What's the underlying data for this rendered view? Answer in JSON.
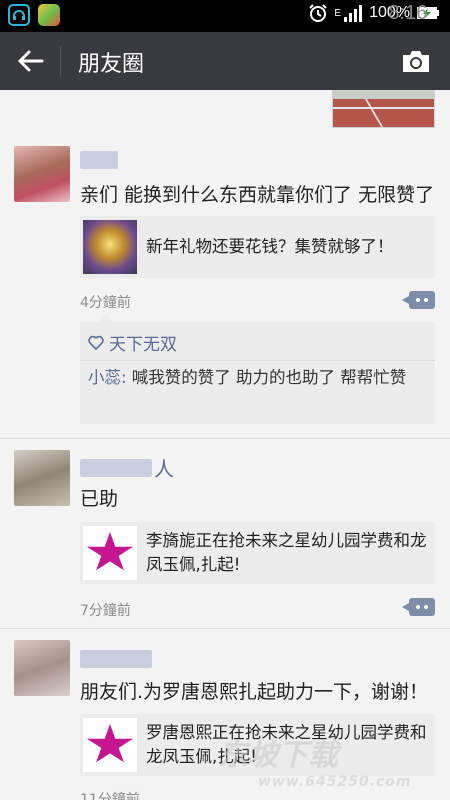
{
  "status_bar": {
    "battery_percent": "100%",
    "time": "8:16",
    "network": "E"
  },
  "app_bar": {
    "title": "朋友圈"
  },
  "posts": [
    {
      "name_suffix": "",
      "text": "亲们 能换到什么东西就靠你们了 无限赞了",
      "share_title": "新年礼物还要花钱？集赞就够了！",
      "time": "4分鐘前",
      "likes": "天下无双",
      "comment_name": "小蕊:",
      "comment_text": " 喊我赞的赞了 助力的也助了  帮帮忙赞"
    },
    {
      "name_suffix": "人",
      "text": "已助",
      "share_title": "李旖旎正在抢未来之星幼儿园学费和龙凤玉佩,扎起!",
      "time": "7分鐘前"
    },
    {
      "name_suffix": "",
      "text": "朋友们.为罗唐恩熙扎起助力一下，谢谢！",
      "share_title": "罗唐恩熙正在抢未来之星幼儿园学费和龙凤玉佩,扎起!",
      "time": "11分鐘前"
    }
  ],
  "logo_text": "未来之星",
  "watermark": {
    "text": "东坡下载",
    "url": "www.645250.com"
  },
  "colors": {
    "app_bar": "#393a3f",
    "link": "#576b95",
    "feed_bg": "#f3f3f3"
  }
}
